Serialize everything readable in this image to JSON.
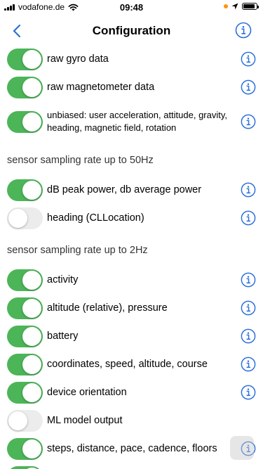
{
  "status_bar": {
    "carrier": "vodafone.de",
    "time": "09:48",
    "battery_level": 0.9
  },
  "nav": {
    "title": "Configuration",
    "back_icon": "chevron-left-icon",
    "info_icon": "info-circle-icon"
  },
  "colors": {
    "accent": "#2a6fdb",
    "toggle_on": "#4cb558",
    "toggle_off": "#ececec"
  },
  "top_rows": [
    {
      "label": "raw gyro data",
      "on": true
    },
    {
      "label": "raw magnetometer data",
      "on": true
    },
    {
      "label": "unbiased: user acceleration, attitude, gravity, heading, magnetic field, rotation",
      "on": true
    }
  ],
  "section_50hz": {
    "header": "sensor sampling rate up to 50Hz",
    "rows": [
      {
        "label": "dB peak power, db average power",
        "on": true
      },
      {
        "label": "heading (CLLocation)",
        "on": false
      }
    ]
  },
  "section_2hz": {
    "header": "sensor sampling rate up to 2Hz",
    "rows": [
      {
        "label": "activity",
        "on": true
      },
      {
        "label": "altitude (relative), pressure",
        "on": true
      },
      {
        "label": "battery",
        "on": true
      },
      {
        "label": "coordinates, speed, altitude, course",
        "on": true
      },
      {
        "label": "device orientation",
        "on": true
      },
      {
        "label": "ML model output",
        "on": false
      },
      {
        "label": "steps, distance, pace, cadence, floors",
        "on": true
      }
    ]
  }
}
